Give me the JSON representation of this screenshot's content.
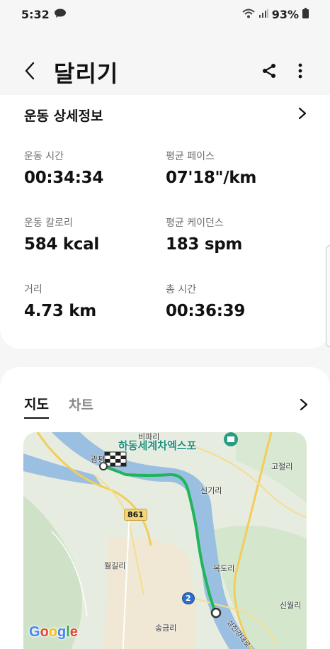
{
  "status_bar": {
    "time": "5:32",
    "battery": "93%",
    "icons": [
      "chat-bubble-icon",
      "wifi-icon",
      "signal-icon",
      "battery-icon"
    ]
  },
  "header": {
    "title": "달리기",
    "icons": [
      "back-icon",
      "share-icon",
      "more-icon"
    ]
  },
  "details": {
    "title": "운동 상세정보",
    "stats": [
      {
        "label": "운동 시간",
        "value": "00:34:34"
      },
      {
        "label": "평균 페이스",
        "value": "07'18\"/km"
      },
      {
        "label": "운동 칼로리",
        "value": "584 kcal"
      },
      {
        "label": "평균 케이던스",
        "value": "183 spm"
      },
      {
        "label": "거리",
        "value": "4.73 km"
      },
      {
        "label": "총 시간",
        "value": "00:36:39"
      }
    ]
  },
  "map_section": {
    "tabs": [
      {
        "label": "지도",
        "active": true
      },
      {
        "label": "차트",
        "active": false
      }
    ],
    "map_labels": {
      "expo": "하동세계차엑스포",
      "bipari": "비파리",
      "gwangpyeong": "광평",
      "singiri": "신기리",
      "gojeolli": "고절리",
      "wolgilli": "월길리",
      "mokdori": "목도리",
      "singeumri": "송금리",
      "sinwolli": "신월리",
      "road": "섬진강대로",
      "route_861": "861",
      "route_2": "2",
      "google": "Google"
    },
    "route_color": "#1fb55a"
  }
}
